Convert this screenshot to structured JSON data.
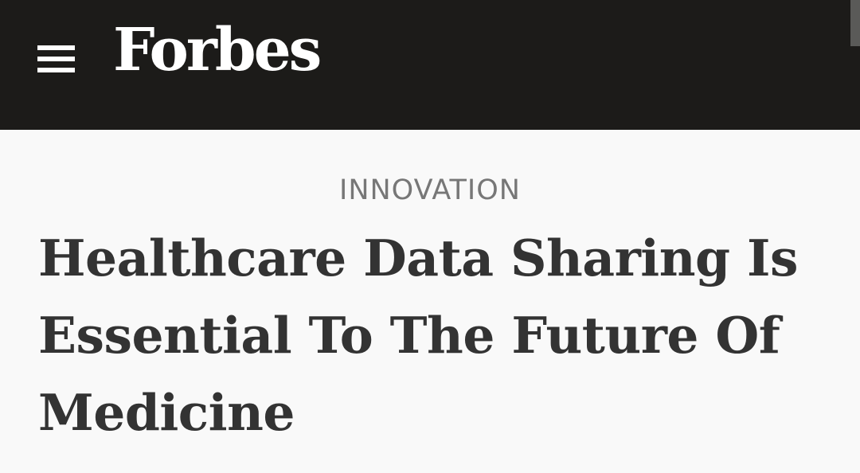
{
  "header": {
    "menu_icon": "hamburger-menu-icon",
    "logo_text": "Forbes",
    "background_color": "#1c1b19"
  },
  "article": {
    "section": "INNOVATION",
    "title": "Healthcare Data Sharing Is Essential To The Future Of Medicine"
  }
}
